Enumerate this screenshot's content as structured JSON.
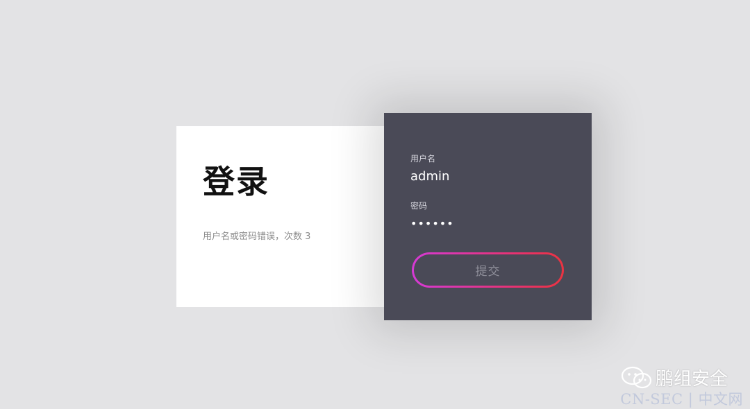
{
  "login": {
    "title": "登录",
    "error_message": "用户名或密码错误，次数 3"
  },
  "form": {
    "username_label": "用户名",
    "username_value": "admin",
    "password_label": "密码",
    "password_value": "••••••",
    "submit_label": "提交"
  },
  "colors": {
    "page_background": "#e3e3e5",
    "form_panel": "#4a4a57",
    "button_gradient_start": "#d63ad6",
    "button_gradient_end": "#ea3340"
  },
  "watermark": {
    "account_name": "鹏组安全",
    "icon": "wechat-icon",
    "site_text": "CN-SEC | 中文网"
  }
}
